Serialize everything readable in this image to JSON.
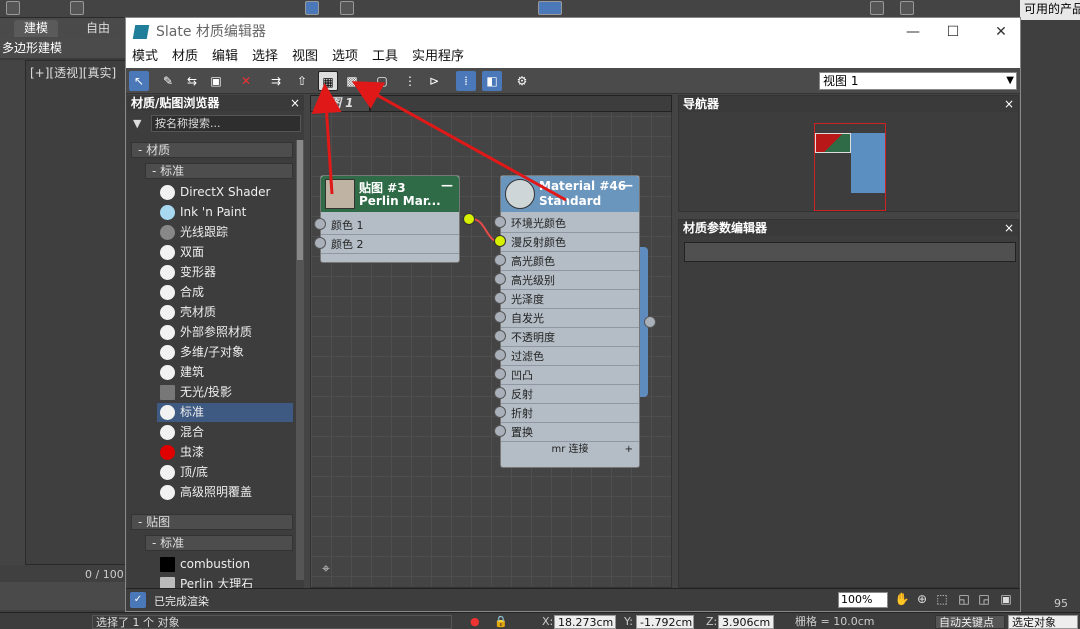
{
  "host": {
    "tabs": [
      "建模",
      "自由形"
    ],
    "subtab": "多边形建模",
    "viewport_label": "[+][透视][真实]",
    "frame_counter": "0 / 100",
    "right_tab": "可用的产品",
    "right_number": "95"
  },
  "window": {
    "title": "Slate 材质编辑器",
    "controls": {
      "minimize": "—",
      "maximize": "☐",
      "close": "✕"
    },
    "menu": [
      "模式",
      "材质",
      "编辑",
      "选择",
      "视图",
      "选项",
      "工具",
      "实用程序"
    ],
    "view_select": "视图 1"
  },
  "browser": {
    "title": "材质/贴图浏览器",
    "close": "×",
    "search_placeholder": "按名称搜索...",
    "materials_group": "- 材质",
    "standard_sub": "- 标准",
    "materials": [
      {
        "label": "DirectX Shader",
        "color": "#f2f2f2"
      },
      {
        "label": "Ink 'n Paint",
        "color": "#a8d8f0"
      },
      {
        "label": "光线跟踪",
        "color": "#888888"
      },
      {
        "label": "双面",
        "color": "#f2f2f2"
      },
      {
        "label": "变形器",
        "color": "#f2f2f2"
      },
      {
        "label": "合成",
        "color": "#f2f2f2"
      },
      {
        "label": "壳材质",
        "color": "#f2f2f2"
      },
      {
        "label": "外部参照材质",
        "color": "#f2f2f2"
      },
      {
        "label": "多维/子对象",
        "color": "#f2f2f2"
      },
      {
        "label": "建筑",
        "color": "#f2f2f2"
      },
      {
        "label": "无光/投影",
        "color": "#777777"
      },
      {
        "label": "标准",
        "color": "#f2f2f2"
      },
      {
        "label": "混合",
        "color": "#f2f2f2"
      },
      {
        "label": "虫漆",
        "color": "#e00000"
      },
      {
        "label": "顶/底",
        "color": "#f2f2f2"
      },
      {
        "label": "高级照明覆盖",
        "color": "#f2f2f2"
      }
    ],
    "maps_group": "- 贴图",
    "maps_sub": "- 标准",
    "maps": [
      {
        "label": "combustion",
        "color": "#000000"
      },
      {
        "label": "Perlin 大理石",
        "color": "#bbbbbb"
      }
    ]
  },
  "view": {
    "tab": "视图 1",
    "map_node": {
      "line1": "贴图 #3",
      "line2": "Perlin Mar...",
      "minimize": "—",
      "slots": [
        "颜色 1",
        "颜色 2"
      ]
    },
    "mat_node": {
      "line1": "Material #46",
      "line2": "Standard",
      "minimize": "—",
      "slots": [
        "环境光颜色",
        "漫反射颜色",
        "高光颜色",
        "高光级别",
        "光泽度",
        "自发光",
        "不透明度",
        "过滤色",
        "凹凸",
        "反射",
        "折射",
        "置换"
      ],
      "footer": "mr 连接",
      "footer_plus": "+"
    }
  },
  "navigator": {
    "title": "导航器",
    "close": "×"
  },
  "params": {
    "title": "材质参数编辑器",
    "close": "×"
  },
  "win_status": {
    "message": "已完成渲染",
    "zoom": "100%"
  },
  "status": {
    "selected": "选择了 1 个 对象",
    "x_label": "X:",
    "x": "18.273cm",
    "y_label": "Y:",
    "y": "-1.792cm",
    "z_label": "Z:",
    "z": "3.906cm",
    "grid": "栅格 = 10.0cm",
    "autokey": "自动关键点",
    "selset": "选定对象"
  },
  "colors": {
    "accent": "#4a78b8",
    "arrow": "#e01818",
    "map_header": "#2e6b46",
    "mat_header": "#6a95bd"
  }
}
